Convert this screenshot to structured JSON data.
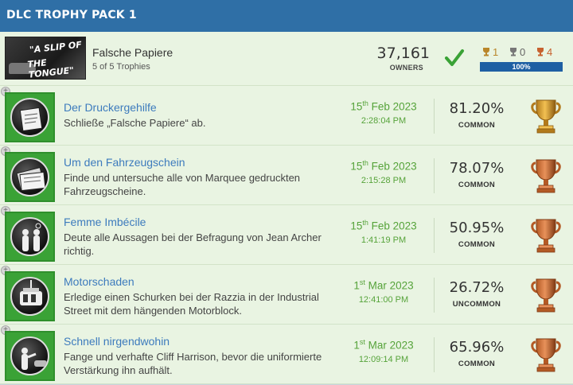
{
  "header": {
    "title": "DLC TROPHY PACK 1"
  },
  "pack": {
    "thumb_line1": "\"A SLIP OF",
    "thumb_line2": "THE TONGUE\"",
    "name": "Falsche Papiere",
    "trophy_count": "5 of 5 Trophies",
    "owners": "37,161",
    "owners_label": "OWNERS",
    "check_icon": "checkmark-icon",
    "gold": "1",
    "silver": "0",
    "bronze": "4",
    "progress": 1.0,
    "progress_label": "100%",
    "colors": {
      "gold": "#b9862a",
      "silver": "#666666",
      "bronze": "#c7622f",
      "progress": "#1e5fa3",
      "header": "#2f6fa6",
      "row": "#e9f4e2"
    }
  },
  "trophies": [
    {
      "name": "Der Druckergehilfe",
      "desc": "Schließe „Falsche Papiere“ ab.",
      "day": "15",
      "ord": "th",
      "month_year": "Feb 2023",
      "time": "2:28:04 PM",
      "pct": "81.20%",
      "rarity": "COMMON",
      "icon": "papers-icon",
      "grade": "gold"
    },
    {
      "name": "Um den Fahrzeugschein",
      "desc": "Finde und untersuche alle von Marquee gedruckten Fahrzeugscheine.",
      "day": "15",
      "ord": "th",
      "month_year": "Feb 2023",
      "time": "2:15:28 PM",
      "pct": "78.07%",
      "rarity": "COMMON",
      "icon": "documents-icon",
      "grade": "bronze"
    },
    {
      "name": "Femme Imbécile",
      "desc": "Deute alle Aussagen bei der Befragung von Jean Archer richtig.",
      "day": "15",
      "ord": "th",
      "month_year": "Feb 2023",
      "time": "1:41:19 PM",
      "pct": "50.95%",
      "rarity": "COMMON",
      "icon": "interrogation-icon",
      "grade": "bronze"
    },
    {
      "name": "Motorschaden",
      "desc": "Erledige einen Schurken bei der Razzia in der Industrial Street mit dem hängenden Motorblock.",
      "day": "1",
      "ord": "st",
      "month_year": "Mar 2023",
      "time": "12:41:00 PM",
      "pct": "26.72%",
      "rarity": "UNCOMMON",
      "icon": "engine-icon",
      "grade": "bronze"
    },
    {
      "name": "Schnell nirgendwohin",
      "desc": "Fange und verhafte Cliff Harrison, bevor die uniformierte Verstärkung ihn aufhält.",
      "day": "1",
      "ord": "st",
      "month_year": "Mar 2023",
      "time": "12:09:14 PM",
      "pct": "65.96%",
      "rarity": "COMMON",
      "icon": "arrest-icon",
      "grade": "bronze"
    }
  ]
}
